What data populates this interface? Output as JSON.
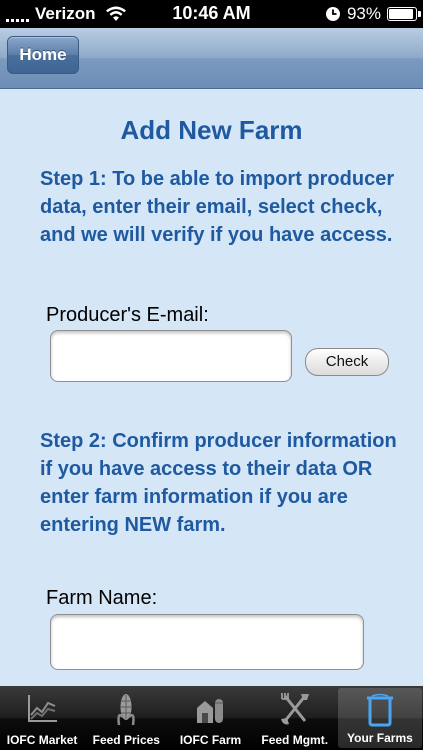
{
  "status_bar": {
    "carrier": "Verizon",
    "time": "10:46 AM",
    "battery": "93%",
    "battery_level": 0.93
  },
  "nav": {
    "home_label": "Home"
  },
  "page": {
    "title": "Add New Farm",
    "step1": "Step 1: To be able to import producer data, enter their email, select check, and we will verify if you have access.",
    "email_label": "Producer's E-mail:",
    "email_value": "",
    "check_label": "Check",
    "step2": "Step 2: Confirm producer information if you have access to their data OR enter farm information if you are entering NEW farm.",
    "farm_name_label": "Farm Name:",
    "farm_name_value": ""
  },
  "tabs": [
    {
      "label": "IOFC Market",
      "icon": "chart-icon",
      "active": false
    },
    {
      "label": "Feed Prices",
      "icon": "corn-icon",
      "active": false
    },
    {
      "label": "IOFC Farm",
      "icon": "barn-icon",
      "active": false
    },
    {
      "label": "Feed Mgmt.",
      "icon": "fork-shovel-icon",
      "active": false
    },
    {
      "label": "Your Farms",
      "icon": "container-icon",
      "active": true
    }
  ],
  "colors": {
    "background": "#d5e6f7",
    "accent_text": "#1f5aa0",
    "nav_bar": "#7c9ac0"
  }
}
